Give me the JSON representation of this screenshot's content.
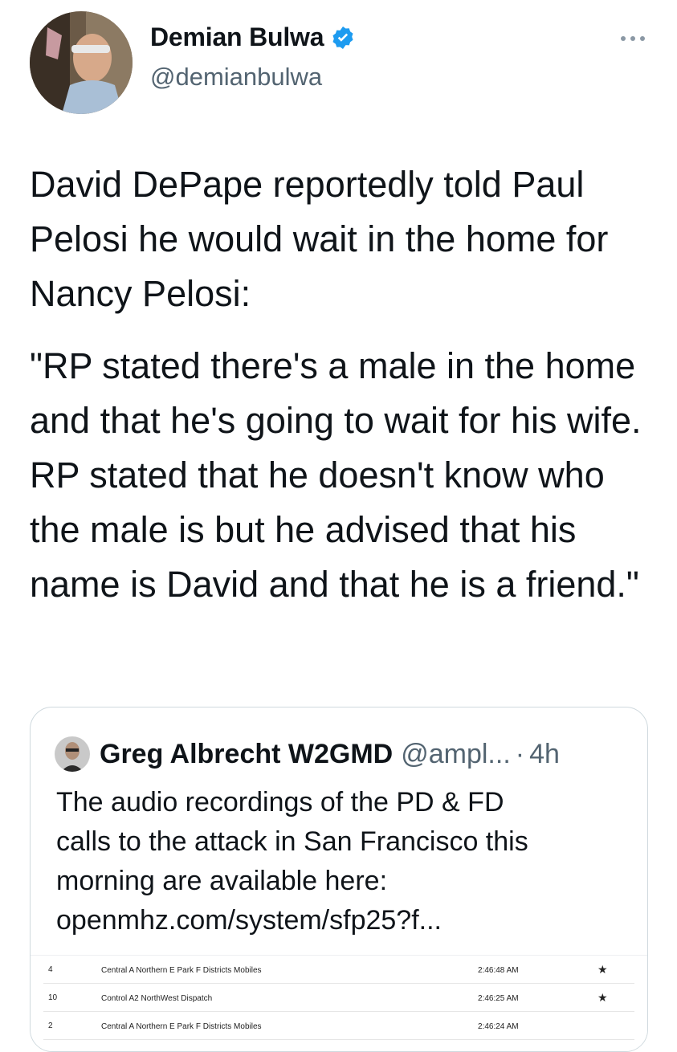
{
  "author": {
    "display_name": "Demian Bulwa",
    "handle": "@demianbulwa",
    "verified": true,
    "avatar_icon": "profile-photo"
  },
  "more_icon": "ellipsis-icon",
  "tweet": {
    "paragraphs": [
      "David DePape reportedly told Paul Pelosi he would wait in the home for Nancy Pelosi:",
      "\"RP stated there's a male in the home and that he's going to wait for his wife. RP stated that he doesn't know who the male is but he advised that his name is David and that he is a friend.\""
    ]
  },
  "quoted_tweet": {
    "display_name": "Greg Albrecht W2GMD",
    "handle": "@ampl...",
    "separator": "·",
    "time": "4h",
    "text_lines": [
      "The audio recordings of the PD & FD",
      "calls to the attack in San Francisco this",
      "morning are available here:",
      "openmhz.com/system/sfp25?f..."
    ],
    "media_rows": [
      {
        "count": "4",
        "label": "Central A Northern E Park F Districts Mobiles",
        "time": "2:46:48 AM",
        "star": "★"
      },
      {
        "count": "10",
        "label": "Control A2 NorthWest Dispatch",
        "time": "2:46:25 AM",
        "star": "★"
      },
      {
        "count": "2",
        "label": "Central A Northern E Park F Districts Mobiles",
        "time": "2:46:24 AM",
        "star": ""
      }
    ]
  },
  "colors": {
    "text": "#0f1419",
    "secondary": "#536471",
    "verified_blue": "#1d9bf0",
    "border": "#cfd9de"
  }
}
